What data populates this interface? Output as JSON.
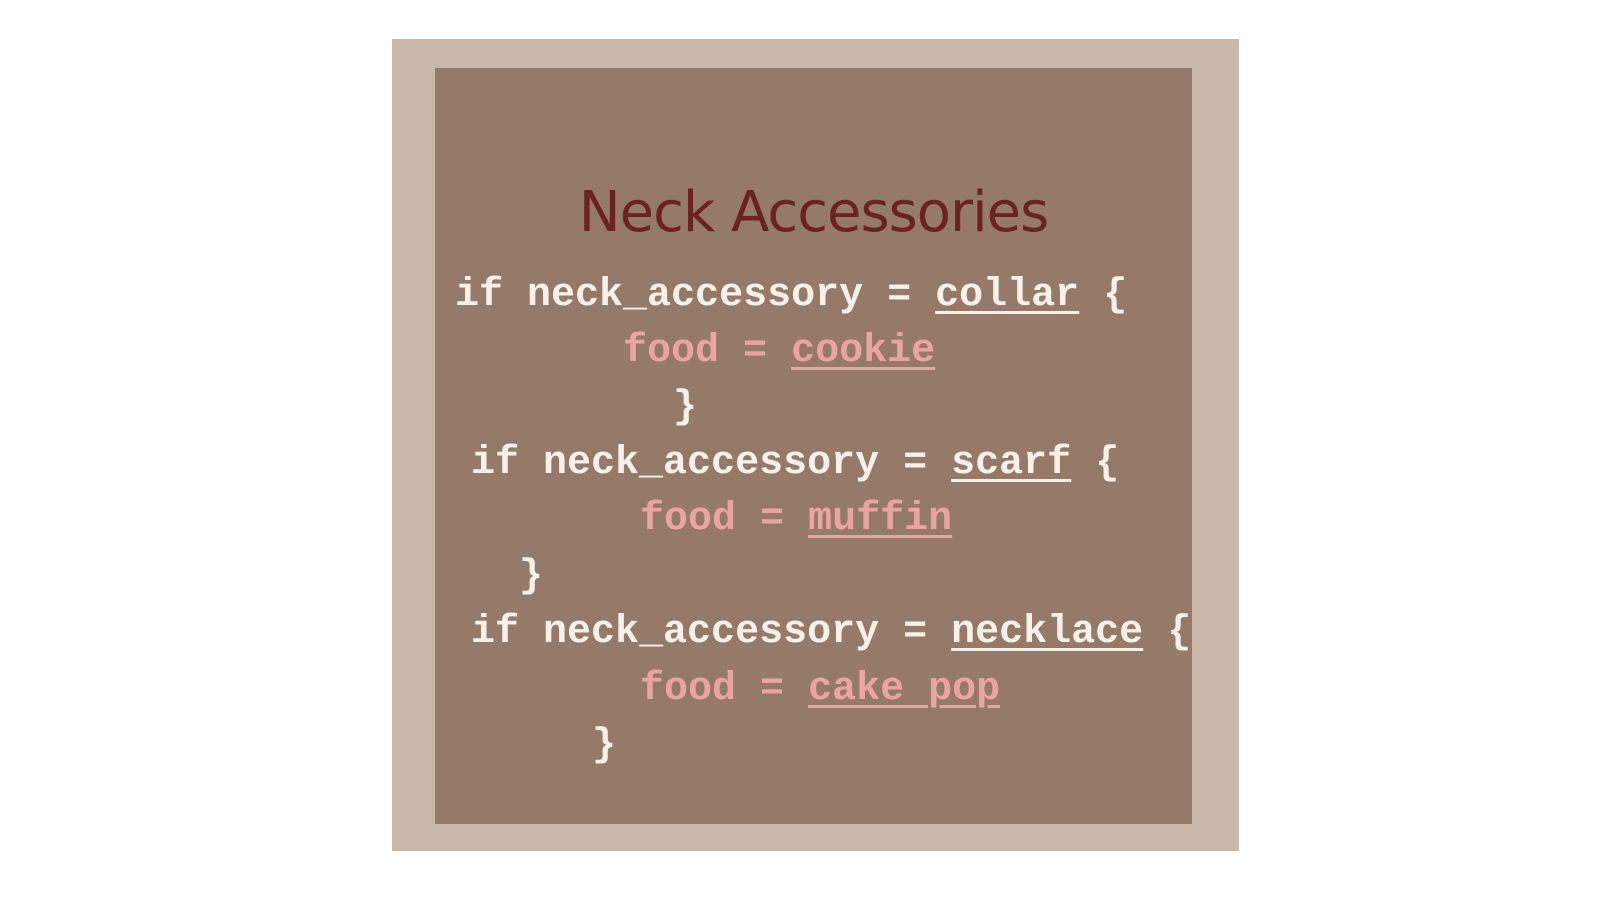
{
  "title": "Neck Accessories",
  "blocks": [
    {
      "keyword": "if",
      "variable": "neck_accessory",
      "op": "=",
      "value": "collar",
      "open": "{",
      "food_var": "food",
      "food_op": "=",
      "food_value": "cookie",
      "close": "}"
    },
    {
      "keyword": "if",
      "variable": "neck_accessory",
      "op": "=",
      "value": "scarf",
      "open": "{",
      "food_var": "food",
      "food_op": "=",
      "food_value": "muffin",
      "close": "}"
    },
    {
      "keyword": "if",
      "variable": "neck_accessory",
      "op": "=",
      "value": "necklace",
      "open": "{",
      "food_var": "food",
      "food_op": "=",
      "food_value": "cake pop",
      "close": "}"
    }
  ],
  "colors": {
    "outer_frame": "#c9b8a8",
    "panel": "#957a6a",
    "title": "#6b2320",
    "code": "#f7f1ea",
    "food": "#eba5a0"
  }
}
